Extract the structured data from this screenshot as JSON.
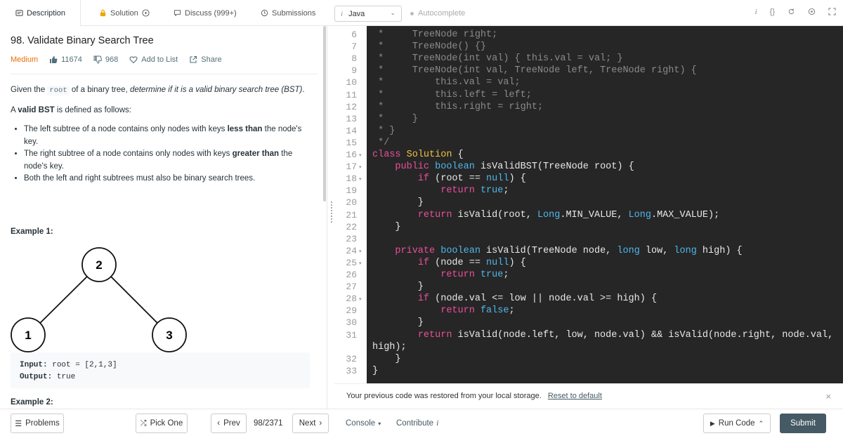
{
  "tabs": [
    {
      "label": "Description"
    },
    {
      "label": "Solution"
    },
    {
      "label": "Discuss (999+)"
    },
    {
      "label": "Submissions"
    }
  ],
  "editor_toolbar": {
    "language": "Java",
    "autocomplete": "Autocomplete",
    "info_glyph": "i",
    "braces_glyph": "{}"
  },
  "problem": {
    "title": "98. Validate Binary Search Tree",
    "difficulty": "Medium",
    "likes": "11674",
    "dislikes": "968",
    "add_to_list": "Add to List",
    "share": "Share",
    "desc_p1_a": "Given the ",
    "desc_p1_code": "root",
    "desc_p1_b": " of a binary tree, ",
    "desc_p1_em": "determine if it is a valid binary search tree (BST)",
    "desc_p1_c": ".",
    "desc_p2_a": "A ",
    "desc_p2_b": "valid BST",
    "desc_p2_c": " is defined as follows:",
    "bullet1_a": "The left subtree of a node contains only nodes with keys ",
    "bullet1_b": "less than",
    "bullet1_c": " the node's key.",
    "bullet2_a": "The right subtree of a node contains only nodes with keys ",
    "bullet2_b": "greater than",
    "bullet2_c": " the node's key.",
    "bullet3": "Both the left and right subtrees must also be binary search trees.",
    "example1_title": "Example 1:",
    "tree_nodes": [
      "2",
      "1",
      "3"
    ],
    "example1_input_label": "Input:",
    "example1_input": "root = [2,1,3]",
    "example1_output_label": "Output:",
    "example1_output": "true",
    "example2_title": "Example 2:"
  },
  "code": {
    "lines": [
      {
        "n": "6",
        "text": " *     TreeNode right;"
      },
      {
        "n": "7",
        "text": " *     TreeNode() {}"
      },
      {
        "n": "8",
        "text": " *     TreeNode(int val) { this.val = val; }"
      },
      {
        "n": "9",
        "text": " *     TreeNode(int val, TreeNode left, TreeNode right) {"
      },
      {
        "n": "10",
        "text": " *         this.val = val;"
      },
      {
        "n": "11",
        "text": " *         this.left = left;"
      },
      {
        "n": "12",
        "text": " *         this.right = right;"
      },
      {
        "n": "13",
        "text": " *     }"
      },
      {
        "n": "14",
        "text": " * }"
      },
      {
        "n": "15",
        "text": " */"
      },
      {
        "n": "16",
        "text": "class Solution {"
      },
      {
        "n": "17",
        "text": "    public boolean isValidBST(TreeNode root) {"
      },
      {
        "n": "18",
        "text": "        if (root == null) {"
      },
      {
        "n": "19",
        "text": "            return true;"
      },
      {
        "n": "20",
        "text": "        }"
      },
      {
        "n": "21",
        "text": "        return isValid(root, Long.MIN_VALUE, Long.MAX_VALUE);"
      },
      {
        "n": "22",
        "text": "    }"
      },
      {
        "n": "23",
        "text": ""
      },
      {
        "n": "24",
        "text": "    private boolean isValid(TreeNode node, long low, long high) {"
      },
      {
        "n": "25",
        "text": "        if (node == null) {"
      },
      {
        "n": "26",
        "text": "            return true;"
      },
      {
        "n": "27",
        "text": "        }"
      },
      {
        "n": "28",
        "text": "        if (node.val <= low || node.val >= high) {"
      },
      {
        "n": "29",
        "text": "            return false;"
      },
      {
        "n": "30",
        "text": "        }"
      },
      {
        "n": "31",
        "text": "        return isValid(node.left, low, node.val) && isValid(node.right, node.val,"
      },
      {
        "n": "",
        "text": "high);"
      },
      {
        "n": "32",
        "text": "    }"
      },
      {
        "n": "33",
        "text": "}"
      }
    ]
  },
  "notice": {
    "text": "Your previous code was restored from your local storage.",
    "link": "Reset to default",
    "close": "×"
  },
  "footer": {
    "problems": "Problems",
    "pick_one": "Pick One",
    "prev": "Prev",
    "page": "98/2371",
    "next": "Next",
    "console": "Console",
    "contribute": "Contribute",
    "run_code": "Run Code",
    "submit": "Submit"
  },
  "colors": {
    "accent": "#455a64",
    "difficulty_medium": "#ef6c00",
    "editor_bg": "#262626"
  }
}
